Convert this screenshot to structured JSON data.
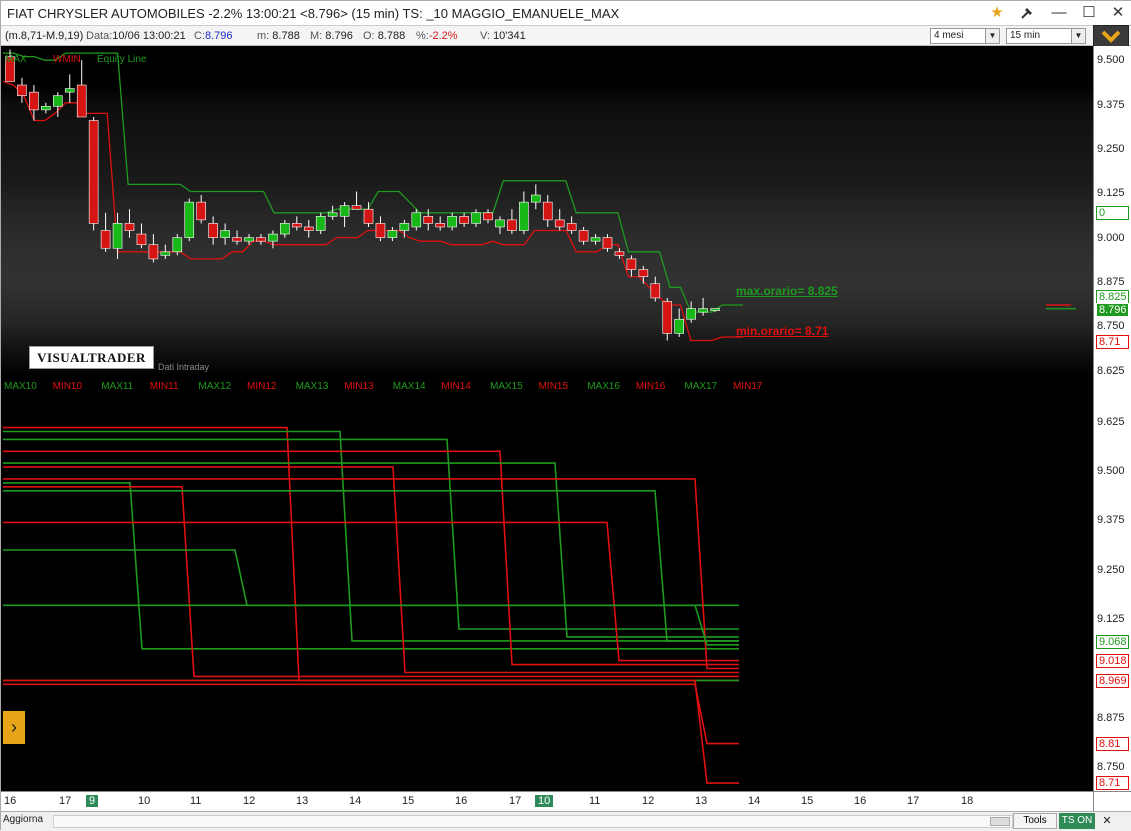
{
  "window": {
    "title": "FIAT CHRYSLER AUTOMOBILES -2.2% 13:00:21  <8.796> (15 min) TS: _10 MAGGIO_EMANUELE_MAX",
    "star_icon": "star-icon",
    "tools_icon": "hammer-icon"
  },
  "infobar": {
    "indicator": "(m.8,71-M.9,19)",
    "data_label": "Data:",
    "data_value": "10/06 13:00:21",
    "c_label": "C:",
    "c_value": "8.796",
    "m_label": "m:",
    "m_value": "8.788",
    "M_label": "M:",
    "M_value": "8.796",
    "o_label": "O:",
    "o_value": "8.788",
    "pct_label": "%:",
    "pct_value": "-2.2%",
    "v_label": "V:",
    "v_value": "10'341",
    "period_select": "4 mesi",
    "interval_select": "15 min"
  },
  "colors": {
    "green": "#1f9a1f",
    "red": "#e01010",
    "candle_green": "#17b817",
    "candle_red": "#d51414"
  },
  "price_panel": {
    "legend": [
      {
        "text": "MAX",
        "color": "#1f9a1f"
      },
      {
        "text": "WMIN",
        "color": "#e01010"
      },
      {
        "text": "Equity Line",
        "color": "#1f9a1f"
      }
    ],
    "logo": "VISUALTRADER",
    "intraday": "Dati Intraday",
    "annot_max": "max.orario= 8.825",
    "annot_min": "min.orario= 8.71",
    "axis_ticks": [
      "9.500",
      "9.375",
      "9.250",
      "9.125",
      "9.000",
      "8.875",
      "8.750",
      "8.625"
    ],
    "axis_extra_label": "0",
    "last_price": "8.796",
    "last_min": "8.71",
    "last_max": "8.825"
  },
  "indicator_panel": {
    "legend": [
      {
        "text": "MAX10",
        "color": "#1f9a1f"
      },
      {
        "text": "MIN10",
        "color": "#e01010"
      },
      {
        "text": "MAX11",
        "color": "#1f9a1f"
      },
      {
        "text": "MIN11",
        "color": "#e01010"
      },
      {
        "text": "MAX12",
        "color": "#1f9a1f"
      },
      {
        "text": "MIN12",
        "color": "#e01010"
      },
      {
        "text": "MAX13",
        "color": "#1f9a1f"
      },
      {
        "text": "MIN13",
        "color": "#e01010"
      },
      {
        "text": "MAX14",
        "color": "#1f9a1f"
      },
      {
        "text": "MIN14",
        "color": "#e01010"
      },
      {
        "text": "MAX15",
        "color": "#1f9a1f"
      },
      {
        "text": "MIN15",
        "color": "#e01010"
      },
      {
        "text": "MAX16",
        "color": "#1f9a1f"
      },
      {
        "text": "MIN16",
        "color": "#e01010"
      },
      {
        "text": "MAX17",
        "color": "#1f9a1f"
      },
      {
        "text": "MIN17",
        "color": "#e01010"
      }
    ],
    "axis_ticks": [
      "9.625",
      "9.500",
      "9.375",
      "9.250",
      "9.125",
      "8.875",
      "8.750"
    ],
    "value_boxes": [
      {
        "text": "9.068",
        "color": "#1f9a1f"
      },
      {
        "text": "9.018",
        "color": "#e01010"
      },
      {
        "text": "8.969",
        "color": "#e01010"
      },
      {
        "text": "8.81",
        "color": "#e01010"
      },
      {
        "text": "8.71",
        "color": "#e01010"
      }
    ]
  },
  "date_axis": {
    "labels": [
      "16",
      "17",
      "9",
      "10",
      "11",
      "12",
      "13",
      "14",
      "15",
      "16",
      "17",
      "10",
      "11",
      "12",
      "13",
      "14",
      "15",
      "16",
      "17",
      "18"
    ],
    "highlighted": [
      "9",
      "10"
    ]
  },
  "statusbar": {
    "aggiorna": "Aggiorna",
    "tools": "Tools",
    "ts_on": "TS ON"
  },
  "chart_data": [
    {
      "type": "candlestick",
      "title": "",
      "xlabel": "",
      "ylabel": "",
      "ylim": [
        8.61,
        9.54
      ],
      "series_overlays": [
        "MAX",
        "WMIN",
        "Equity Line"
      ],
      "candles": [
        {
          "o": 9.51,
          "h": 9.53,
          "l": 9.44,
          "c": 9.44,
          "dir": "down"
        },
        {
          "o": 9.43,
          "h": 9.45,
          "l": 9.38,
          "c": 9.4,
          "dir": "down"
        },
        {
          "o": 9.41,
          "h": 9.43,
          "l": 9.33,
          "c": 9.36,
          "dir": "down"
        },
        {
          "o": 9.36,
          "h": 9.38,
          "l": 9.35,
          "c": 9.37,
          "dir": "up"
        },
        {
          "o": 9.37,
          "h": 9.41,
          "l": 9.34,
          "c": 9.4,
          "dir": "up"
        },
        {
          "o": 9.41,
          "h": 9.46,
          "l": 9.38,
          "c": 9.42,
          "dir": "up"
        },
        {
          "o": 9.43,
          "h": 9.5,
          "l": 9.35,
          "c": 9.34,
          "dir": "down"
        },
        {
          "o": 9.33,
          "h": 9.34,
          "l": 9.02,
          "c": 9.04,
          "dir": "down"
        },
        {
          "o": 9.02,
          "h": 9.07,
          "l": 8.96,
          "c": 8.97,
          "dir": "down"
        },
        {
          "o": 8.97,
          "h": 9.07,
          "l": 8.94,
          "c": 9.04,
          "dir": "up"
        },
        {
          "o": 9.04,
          "h": 9.08,
          "l": 9.0,
          "c": 9.02,
          "dir": "down"
        },
        {
          "o": 9.01,
          "h": 9.04,
          "l": 8.97,
          "c": 8.98,
          "dir": "down"
        },
        {
          "o": 8.98,
          "h": 9.01,
          "l": 8.93,
          "c": 8.94,
          "dir": "down"
        },
        {
          "o": 8.95,
          "h": 8.98,
          "l": 8.94,
          "c": 8.96,
          "dir": "up"
        },
        {
          "o": 8.96,
          "h": 9.01,
          "l": 8.95,
          "c": 9.0,
          "dir": "up"
        },
        {
          "o": 9.0,
          "h": 9.11,
          "l": 8.99,
          "c": 9.1,
          "dir": "up"
        },
        {
          "o": 9.1,
          "h": 9.12,
          "l": 9.04,
          "c": 9.05,
          "dir": "down"
        },
        {
          "o": 9.04,
          "h": 9.06,
          "l": 8.98,
          "c": 9.0,
          "dir": "down"
        },
        {
          "o": 9.0,
          "h": 9.04,
          "l": 8.98,
          "c": 9.02,
          "dir": "up"
        },
        {
          "o": 9.0,
          "h": 9.02,
          "l": 8.98,
          "c": 8.99,
          "dir": "down"
        },
        {
          "o": 8.99,
          "h": 9.01,
          "l": 8.98,
          "c": 9.0,
          "dir": "up"
        },
        {
          "o": 9.0,
          "h": 9.01,
          "l": 8.98,
          "c": 8.99,
          "dir": "down"
        },
        {
          "o": 8.99,
          "h": 9.02,
          "l": 8.97,
          "c": 9.01,
          "dir": "up"
        },
        {
          "o": 9.01,
          "h": 9.05,
          "l": 9.0,
          "c": 9.04,
          "dir": "up"
        },
        {
          "o": 9.04,
          "h": 9.06,
          "l": 9.02,
          "c": 9.03,
          "dir": "down"
        },
        {
          "o": 9.03,
          "h": 9.05,
          "l": 9.0,
          "c": 9.02,
          "dir": "down"
        },
        {
          "o": 9.02,
          "h": 9.07,
          "l": 9.01,
          "c": 9.06,
          "dir": "up"
        },
        {
          "o": 9.06,
          "h": 9.09,
          "l": 9.05,
          "c": 9.07,
          "dir": "up"
        },
        {
          "o": 9.06,
          "h": 9.1,
          "l": 9.03,
          "c": 9.09,
          "dir": "up"
        },
        {
          "o": 9.09,
          "h": 9.13,
          "l": 9.08,
          "c": 9.08,
          "dir": "down"
        },
        {
          "o": 9.08,
          "h": 9.1,
          "l": 9.03,
          "c": 9.04,
          "dir": "down"
        },
        {
          "o": 9.04,
          "h": 9.06,
          "l": 8.99,
          "c": 9.0,
          "dir": "down"
        },
        {
          "o": 9.0,
          "h": 9.03,
          "l": 8.99,
          "c": 9.02,
          "dir": "up"
        },
        {
          "o": 9.02,
          "h": 9.05,
          "l": 9.0,
          "c": 9.04,
          "dir": "up"
        },
        {
          "o": 9.03,
          "h": 9.08,
          "l": 9.02,
          "c": 9.07,
          "dir": "up"
        },
        {
          "o": 9.06,
          "h": 9.08,
          "l": 9.02,
          "c": 9.04,
          "dir": "down"
        },
        {
          "o": 9.04,
          "h": 9.06,
          "l": 9.02,
          "c": 9.03,
          "dir": "down"
        },
        {
          "o": 9.03,
          "h": 9.07,
          "l": 9.02,
          "c": 9.06,
          "dir": "up"
        },
        {
          "o": 9.06,
          "h": 9.07,
          "l": 9.03,
          "c": 9.04,
          "dir": "down"
        },
        {
          "o": 9.04,
          "h": 9.08,
          "l": 9.03,
          "c": 9.07,
          "dir": "up"
        },
        {
          "o": 9.07,
          "h": 9.08,
          "l": 9.04,
          "c": 9.05,
          "dir": "down"
        },
        {
          "o": 9.03,
          "h": 9.06,
          "l": 9.01,
          "c": 9.05,
          "dir": "up"
        },
        {
          "o": 9.05,
          "h": 9.08,
          "l": 9.01,
          "c": 9.02,
          "dir": "down"
        },
        {
          "o": 9.02,
          "h": 9.13,
          "l": 9.01,
          "c": 9.1,
          "dir": "up"
        },
        {
          "o": 9.1,
          "h": 9.15,
          "l": 9.08,
          "c": 9.12,
          "dir": "up"
        },
        {
          "o": 9.1,
          "h": 9.12,
          "l": 9.03,
          "c": 9.05,
          "dir": "down"
        },
        {
          "o": 9.05,
          "h": 9.08,
          "l": 9.02,
          "c": 9.03,
          "dir": "down"
        },
        {
          "o": 9.04,
          "h": 9.06,
          "l": 9.01,
          "c": 9.02,
          "dir": "down"
        },
        {
          "o": 9.02,
          "h": 9.03,
          "l": 8.98,
          "c": 8.99,
          "dir": "down"
        },
        {
          "o": 8.99,
          "h": 9.01,
          "l": 8.98,
          "c": 9.0,
          "dir": "up"
        },
        {
          "o": 9.0,
          "h": 9.01,
          "l": 8.96,
          "c": 8.97,
          "dir": "down"
        },
        {
          "o": 8.96,
          "h": 8.97,
          "l": 8.94,
          "c": 8.95,
          "dir": "down"
        },
        {
          "o": 8.94,
          "h": 8.95,
          "l": 8.89,
          "c": 8.91,
          "dir": "down"
        },
        {
          "o": 8.91,
          "h": 8.92,
          "l": 8.87,
          "c": 8.89,
          "dir": "down"
        },
        {
          "o": 8.87,
          "h": 8.89,
          "l": 8.82,
          "c": 8.83,
          "dir": "down"
        },
        {
          "o": 8.82,
          "h": 8.83,
          "l": 8.71,
          "c": 8.73,
          "dir": "down"
        },
        {
          "o": 8.73,
          "h": 8.8,
          "l": 8.72,
          "c": 8.77,
          "dir": "up"
        },
        {
          "o": 8.77,
          "h": 8.82,
          "l": 8.76,
          "c": 8.8,
          "dir": "up"
        },
        {
          "o": 8.79,
          "h": 8.83,
          "l": 8.78,
          "c": 8.8,
          "dir": "up"
        },
        {
          "o": 8.8,
          "h": 8.8,
          "l": 8.79,
          "c": 8.8,
          "dir": "up"
        }
      ],
      "max_line": [
        9.52,
        9.52,
        9.51,
        9.51,
        9.5,
        9.5,
        9.52,
        9.52,
        9.52,
        9.52,
        9.52,
        9.52,
        9.15,
        9.15,
        9.15,
        9.15,
        9.15,
        9.15,
        9.13,
        9.13,
        9.13,
        9.13,
        9.13,
        9.13,
        9.13,
        9.13,
        9.07,
        9.07,
        9.07,
        9.07,
        9.07,
        9.07,
        9.08,
        9.08,
        9.08,
        9.08,
        9.13,
        9.13,
        9.13,
        9.1,
        9.07,
        9.07,
        9.07,
        9.07,
        9.07,
        9.07,
        9.07,
        9.07,
        9.16,
        9.16,
        9.16,
        9.16,
        9.16,
        9.16,
        9.16,
        9.07,
        9.07,
        9.07,
        9.07,
        9.07,
        8.96,
        8.96,
        8.96,
        8.96,
        8.86,
        8.86,
        8.79,
        8.79,
        8.79,
        8.81,
        8.81,
        8.81
      ],
      "min_line": [
        9.44,
        9.43,
        9.4,
        9.33,
        9.33,
        9.35,
        9.38,
        9.38,
        9.35,
        9.35,
        9.35,
        8.96,
        8.96,
        8.96,
        8.96,
        8.96,
        8.96,
        8.96,
        8.94,
        8.94,
        8.94,
        8.94,
        8.96,
        8.96,
        8.99,
        8.99,
        8.98,
        8.98,
        8.98,
        8.98,
        8.98,
        8.98,
        9.0,
        9.0,
        9.0,
        9.02,
        9.02,
        9.02,
        9.02,
        9.0,
        8.99,
        8.99,
        8.99,
        8.98,
        8.98,
        8.98,
        8.98,
        8.99,
        8.98,
        8.98,
        8.98,
        9.02,
        9.02,
        9.02,
        9.02,
        8.96,
        8.96,
        8.96,
        8.98,
        8.98,
        8.89,
        8.89,
        8.86,
        8.83,
        8.81,
        8.81,
        8.71,
        8.71,
        8.71,
        8.72,
        8.72,
        8.72
      ]
    },
    {
      "type": "line",
      "title": "",
      "xlabel": "",
      "ylabel": "",
      "ylim": [
        8.69,
        9.69
      ],
      "series": [
        {
          "name": "MAX10",
          "color": "green",
          "values": [
            9.47,
            9.47,
            9.05,
            9.05,
            9.05,
            9.05,
            9.05
          ]
        },
        {
          "name": "MIN10",
          "color": "red",
          "values": [
            9.46,
            9.46,
            8.98,
            8.98,
            8.98,
            8.98,
            8.98
          ]
        },
        {
          "name": "MAX11",
          "color": "green",
          "values": [
            9.3,
            9.3,
            9.16,
            9.16,
            9.16,
            9.16,
            9.16
          ]
        },
        {
          "name": "MIN11",
          "color": "red",
          "values": [
            9.61,
            9.61,
            8.97,
            8.97,
            8.97,
            8.97,
            8.97
          ]
        },
        {
          "name": "MAX12",
          "color": "green",
          "values": [
            9.6,
            9.6,
            9.07,
            9.07,
            9.07,
            9.07,
            9.07
          ]
        },
        {
          "name": "MIN12",
          "color": "red",
          "values": [
            9.51,
            9.51,
            8.99,
            8.99,
            8.99,
            8.99,
            8.99
          ]
        },
        {
          "name": "MAX13",
          "color": "green",
          "values": [
            9.58,
            9.58,
            9.1,
            9.1,
            9.1,
            9.1,
            9.1
          ]
        },
        {
          "name": "MIN13",
          "color": "red",
          "values": [
            9.55,
            9.55,
            9.01,
            9.01,
            9.01,
            9.01,
            9.01
          ]
        },
        {
          "name": "MAX14",
          "color": "green",
          "values": [
            9.52,
            9.52,
            9.08,
            9.08,
            9.08,
            9.08,
            9.08
          ]
        },
        {
          "name": "MIN14",
          "color": "red",
          "values": [
            9.37,
            9.37,
            9.02,
            9.02,
            9.02,
            9.02,
            9.02
          ]
        },
        {
          "name": "MAX15",
          "color": "green",
          "values": [
            9.45,
            9.45,
            9.07,
            9.07,
            9.07,
            9.07,
            9.07
          ]
        },
        {
          "name": "MIN15",
          "color": "red",
          "values": [
            9.48,
            9.48,
            9.0,
            9.0,
            9.0,
            9.0,
            9.0
          ]
        },
        {
          "name": "MAX16",
          "color": "green",
          "values": [
            9.16,
            9.16,
            9.06,
            9.06,
            9.06,
            9.06,
            9.06
          ]
        },
        {
          "name": "MIN16",
          "color": "red",
          "values": [
            8.96,
            8.96,
            8.81,
            8.81,
            8.81,
            8.81,
            8.81
          ]
        },
        {
          "name": "MAX17",
          "color": "green",
          "values": [
            8.97,
            8.97,
            8.97,
            8.97,
            8.97,
            8.97,
            8.97
          ]
        },
        {
          "name": "MIN17",
          "color": "red",
          "values": [
            8.97,
            8.97,
            8.71,
            8.71,
            8.71,
            8.71,
            8.71
          ]
        }
      ]
    }
  ]
}
